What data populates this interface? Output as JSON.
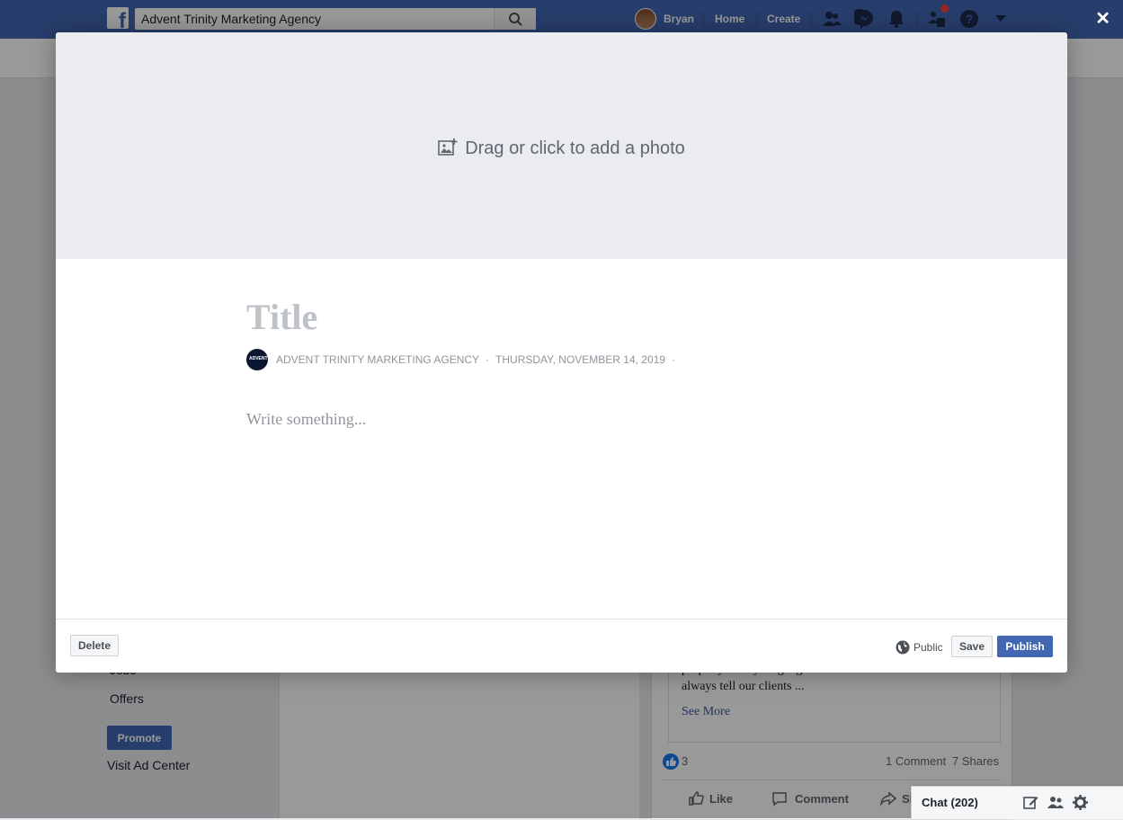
{
  "topbar": {
    "search_value": "Advent Trinity Marketing Agency",
    "user_name": "Bryan",
    "nav_home": "Home",
    "nav_create": "Create",
    "close_symbol": "✕",
    "icons": [
      "search-icon",
      "friend-requests-icon",
      "messenger-icon",
      "notifications-icon",
      "pages-icon",
      "help-icon",
      "account-menu-icon"
    ]
  },
  "background_page": {
    "left_items": [
      "Jobs",
      "Offers"
    ],
    "promote_label": "Promote",
    "ad_center_label": "Visit Ad Center",
    "post": {
      "excerpt_line1": "properly. Every single g",
      "excerpt_line2": "always tell our clients ...",
      "see_more": "See More",
      "reaction_count": "3",
      "comment_count": "1 Comment",
      "share_count": "7 Shares",
      "action_like": "Like",
      "action_comment": "Comment",
      "action_share": "Share"
    },
    "chat": {
      "label": "Chat (202)"
    }
  },
  "modal": {
    "photo_prompt": "Drag or click to add a photo",
    "title_placeholder": "Title",
    "author": "ADVENT TRINITY MARKETING AGENCY",
    "date": "THURSDAY, NOVEMBER 14, 2019",
    "separator": "·",
    "body_placeholder": "Write something...",
    "delete_label": "Delete",
    "privacy_label": "Public",
    "save_label": "Save",
    "publish_label": "Publish"
  },
  "colors": {
    "brand_blue": "#4267b2",
    "photo_area_bg": "#ebecf0",
    "placeholder_grey": "#90949c",
    "notification_red": "#fa3e3e"
  }
}
